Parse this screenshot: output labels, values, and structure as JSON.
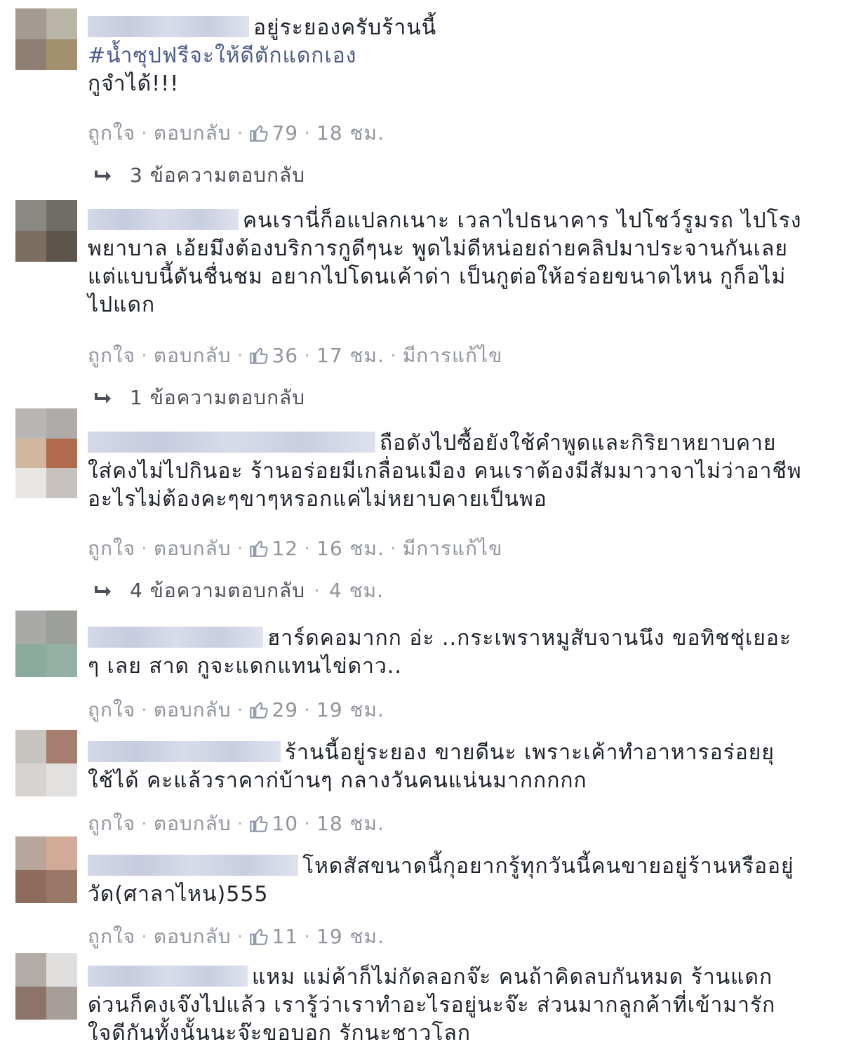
{
  "labels": {
    "like": "ถูกใจ",
    "reply": "ตอบกลับ",
    "edited": "มีการแก้ไข",
    "separator": "·"
  },
  "comments": [
    {
      "lines": [
        "อยู่ระยองครับร้านนี้",
        "#น้ำซุปฟรีจะให้ดีตักแดกเอง",
        "กูจำได้!!!"
      ],
      "likes": "79",
      "time": "18 ชม.",
      "replies": "3 ข้อความตอบกลับ"
    },
    {
      "lines": [
        "คนเรานี่ก็อแปลกเนาะ เวลาไปธนาคาร ไปโชว์รูมรถ ไปโรง",
        "พยาบาล เอ้ยมึงต้องบริการกูดีๆนะ พูดไม่ดีหน่อยถ่ายคลิปมาประจานกันเลย",
        "แต่แบบนี้ดันชื่นชม อยากไปโดนเค้าด่า เป็นกูต่อให้อร่อยขนาดไหน กูก็อไม่",
        "ไปแดก"
      ],
      "likes": "36",
      "time": "17 ชม.",
      "edited": true,
      "replies": "1 ข้อความตอบกลับ"
    },
    {
      "lines": [
        "ถือดังไปซื้อยังใช้คำพูดและกิริยาหยาบคาย",
        "ใส่คงไม่ไปกินอะ ร้านอร่อยมีเกลื่อนเมือง คนเราต้องมีสัมมาวาจาไม่ว่าอาชีพ",
        "อะไรไม่ต้องคะๆขาๆหรอกแค่ไม่หยาบคายเป็นพอ"
      ],
      "likes": "12",
      "time": "16 ชม.",
      "edited": true,
      "replies": "4 ข้อความตอบกลับ",
      "replies_time": "4 ชม."
    },
    {
      "lines": [
        "ฮาร์ดคอมากก อ่ะ ..กระเพราหมูสับจานนึง ขอทิชชุ่เยอะ",
        "ๆ เลย สาด กูจะแดกแทนไข่ดาว.."
      ],
      "likes": "29",
      "time": "19 ชม."
    },
    {
      "lines": [
        "ร้านนี้อยู่ระยอง ขายดีนะ เพราะเค้าทำอาหารอร่อยยุ",
        "ใช้ได้ คะแล้วราคาก่บ้านๆ กลางวันคนแน่นมากกกกก"
      ],
      "likes": "10",
      "time": "18 ชม."
    },
    {
      "lines": [
        "โหดสัสขนาดนี้กุอยากรู้ทุกวันนี้คนขายอยู่ร้านหรืออยู่",
        "วัด(ศาลาไหน)555"
      ],
      "likes": "11",
      "time": "19 ชม."
    },
    {
      "lines": [
        "แหม แม่ค้าก็ไม่กัดลอกจ๊ะ คนถ้าคิดลบกันหมด ร้านแดก",
        "ด่วนก็คงเจ๊งไปแล้ว เรารู้ว่าเราทำอะไรอยู่นะจ๊ะ ส่วนมากลูกค้าที่เข้ามารัก",
        "ใจดีกันทั้งนั้นนะจ๊ะขอบอก รักนะชาวโลก"
      ]
    }
  ],
  "colors": {
    "text": "#1d2129",
    "meta": "#90949c",
    "hashtag": "#4b5a8a",
    "name_blur": "#cfd3e4"
  },
  "icons": {
    "like": "thumbs-up-icon",
    "reply": "reply-arrow-icon"
  }
}
